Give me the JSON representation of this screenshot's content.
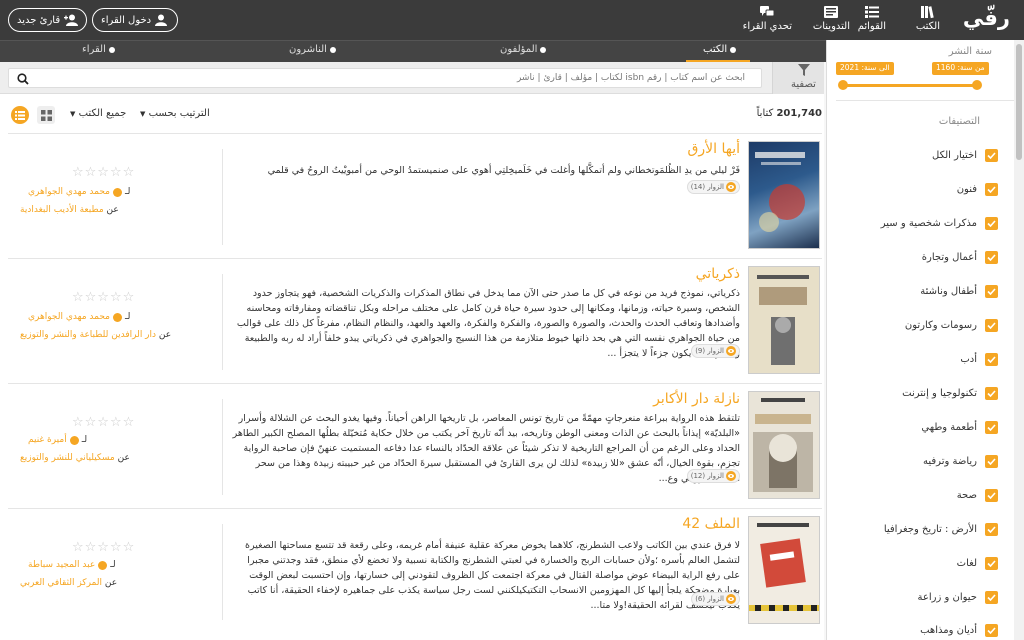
{
  "brand": {
    "logo_text": "رفّي",
    "accent": "#f5a623",
    "topbar_bg": "#3b3b3b"
  },
  "nav": [
    {
      "label": "الكتب",
      "icon": "books-icon"
    },
    {
      "label": "القوائم",
      "icon": "list-icon"
    },
    {
      "label": "التدوينات",
      "icon": "posts-icon"
    },
    {
      "label": "تحدي القراء",
      "icon": "challenge-icon"
    }
  ],
  "auth": {
    "login_label": "دخول القراء",
    "register_label": "قارئ جديد"
  },
  "tabs": [
    {
      "label": "الكتب",
      "active": true
    },
    {
      "label": "المؤلفون",
      "active": false
    },
    {
      "label": "الناشرون",
      "active": false
    },
    {
      "label": "القراء",
      "active": false
    }
  ],
  "search": {
    "filter_label": "تصفية",
    "placeholder": "ابحث عن اسم كتاب | رقم isbn لكتاب | مؤلف | قارئ | ناشر"
  },
  "results": {
    "count": "201,740",
    "count_label": "كتاباً",
    "sort_label": "الترتيب بحسب",
    "type_label": "جميع الكتب"
  },
  "sidebar": {
    "year_title": "سنة النشر",
    "from_year": "من سنة: 1160",
    "to_year": "الى سنة: 2021",
    "categories_title": "التصنيفات",
    "categories": [
      "اختيار الكل",
      "فنون",
      "مذكرات شخصية و سير",
      "أعمال وتجارة",
      "أطفال وناشئة",
      "رسومات وكارتون",
      "أدب",
      "تكنولوجيا و إنترنت",
      "أطعمة وطهي",
      "رياضة وترفيه",
      "صحة",
      "الأرض : تاريخ وجغرافيا",
      "لغات",
      "حيوان و زراعة",
      "أديان ومذاهب"
    ]
  },
  "books": [
    {
      "title": "أيها الأرق",
      "description": "فَرْ ليلي من يدِ الظُلمَوتخطاني ولم أتمكَّلها وأغلت في خَلَميخِلتِي أهوي على صنميستمدُ الوحي من أمبويْيتُ الروحُ في قلمي",
      "visits": "الزوار (14)",
      "author_prefix": "لـ",
      "author": "محمد مهدي الجواهري",
      "publisher_prefix": "عن",
      "publisher": "مطبعة الأديب البغدادية",
      "rating": "0 / 5"
    },
    {
      "title": "ذكرياتي",
      "description": "ذكرياتي، نموذج فريد من نوعه في كل ما صدر حتى الآن مما يدخل في نطاق المذكرات والذكريات الشخصية، فهو يتجاوز حدود الشخص، وسيرة حياته، وزمانها، ومكانها إلى حدود سيرة حياة قرن كامل على مختلف مراحله وبكل تناقضاته ومفارقاته ومحاسنه وأضدادها وتعاقب الحدث والحدث، والصورة والصورة، والفكرة والفكرة، والعهد والعهد، والنظام النظام، مفرغاً كل ذلك على قوالب من حياة الجواهري نفسه التي هي بحد ذاتها خيوط متلازمة من هذا النسيج والجواهري في ذكرياتي يبدو خلفاً أراد له ربه والطبيعة والقدر أن لا يكون جزءاً لا يتجزأ ...",
      "visits": "الزوار (9)",
      "author_prefix": "لـ",
      "author": "محمد مهدي الجواهري",
      "publisher_prefix": "عن",
      "publisher": "دار الرافدين للطباعة والنشر والتوزيع",
      "rating": "0 / 5"
    },
    {
      "title": "نازلة دار الأكابر",
      "description": "تلتقط هذه الرواية ببراعة منعرجاتٍ مهمّةً من تاريخ تونس المعاصر، بل تاريخها الراهن أحياناً. وفيها يغدو البحث عن الشلالة وأسرار «البلديّة» إيذاناً بالبحث عن الذات ومعنى الوطن وتاريخه، بيد أنّه تاريخ آخر يكتب من خلال حكاية مُتخيّلة بطلُها المصلح الكبير الطاهر الحداد وعلى الرغم من أن المراجع التاريخية لا تذكر شيئاً عن علاقة الحدّاد بالنساء عدا دفاعه المستميت عنهنّ فإن صاحبة الرواية تجزم، بقوة الخيال، أنّه عشق «للا زبيدة» لذلك لن يرى القارئ في المستقبل سيرةَ الحدّاد من غير حبيبته زبيدة وهذا من سحر التخييل الروائي وع...",
      "visits": "الزوار (12)",
      "author_prefix": "لـ",
      "author": "أميرة غنيم",
      "publisher_prefix": "عن",
      "publisher": "مسكيلياني للنشر والتوزيع",
      "rating": "0 / 5"
    },
    {
      "title": "الملف 42",
      "description": "لا فرق عندي بين الكاتب ولاعب الشطرنج، كلاهما يخوض معركة عقلية عنيفة أمام غريمه، وعلى رقعة قد تتسع مساحتها الصغيرة لتشمل العالم بأسره ؛ولأن حسابات الربح والخسارة في لعبتي الشطرنج والكتابة نسبية ولا تخضع لأي منطق، فقد وجدتني مجبرا على رفع الراية البيضاء عوض مواصلة القتال في معركة اجتمعت كل الظروف لتقودني إلى خسارتها، وإن احتسبت لبعض الوقت بعبارة مضحكة يلجأ إليها كل المهزومين الانسحاب التكتيكيلكنني لست رجل سياسة يكذب على جماهيره لإخفاء الحقيقة، أنا كاتب يكذب ليكشف لقرائه الحقيقة!ولا متا...",
      "visits": "الزوار (6)",
      "author_prefix": "لـ",
      "author": "عبد المجيد سباطة",
      "publisher_prefix": "عن",
      "publisher": "المركز الثقافي العربي",
      "rating": "0 / 5"
    }
  ]
}
